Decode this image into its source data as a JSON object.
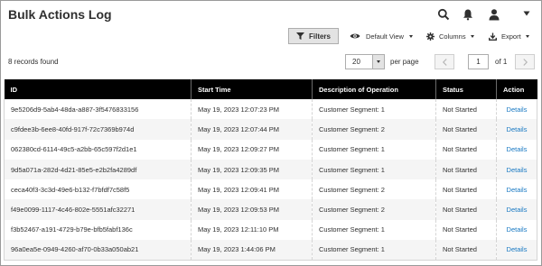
{
  "page": {
    "title": "Bulk Actions Log"
  },
  "toolbar": {
    "filters_label": "Filters",
    "view_label": "Default View",
    "columns_label": "Columns",
    "export_label": "Export"
  },
  "header_icons": [
    "search-icon",
    "bell-icon",
    "user-icon",
    "chevron-down-icon"
  ],
  "grid": {
    "records_found": "8 records found",
    "per_page_value": "20",
    "per_page_label": "per page",
    "page_value": "1",
    "page_of": "of 1",
    "columns": [
      "ID",
      "Start Time",
      "Description of Operation",
      "Status",
      "Action"
    ],
    "rows": [
      {
        "id": "9e5206d9-5ab4-48da-a887-3f5476833156",
        "start": "May 19, 2023 12:07:23 PM",
        "desc": "Customer Segment: 1",
        "status": "Not Started",
        "action": "Details"
      },
      {
        "id": "c9fdee3b-6ee8-40fd-917f-72c7369b974d",
        "start": "May 19, 2023 12:07:44 PM",
        "desc": "Customer Segment: 2",
        "status": "Not Started",
        "action": "Details"
      },
      {
        "id": "062380cd-6114-49c5-a2bb-65c597f2d1e1",
        "start": "May 19, 2023 12:09:27 PM",
        "desc": "Customer Segment: 1",
        "status": "Not Started",
        "action": "Details"
      },
      {
        "id": "9d5a071a-282d-4d21-85e5-e2b2fa4289df",
        "start": "May 19, 2023 12:09:35 PM",
        "desc": "Customer Segment: 1",
        "status": "Not Started",
        "action": "Details"
      },
      {
        "id": "ceca40f3-3c3d-49e6-b132-f7bfdf7c58f5",
        "start": "May 19, 2023 12:09:41 PM",
        "desc": "Customer Segment: 2",
        "status": "Not Started",
        "action": "Details"
      },
      {
        "id": "f49e0099-1117-4c46-802e-5551afc32271",
        "start": "May 19, 2023 12:09:53 PM",
        "desc": "Customer Segment: 2",
        "status": "Not Started",
        "action": "Details"
      },
      {
        "id": "f3b52467-a191-4729-b79e-bfb5fabf136c",
        "start": "May 19, 2023 12:11:10 PM",
        "desc": "Customer Segment: 1",
        "status": "Not Started",
        "action": "Details"
      },
      {
        "id": "96a0ea5e-0949-4260-af70-0b33a050ab21",
        "start": "May 19, 2023 1:44:06 PM",
        "desc": "Customer Segment: 1",
        "status": "Not Started",
        "action": "Details"
      }
    ]
  },
  "colors": {
    "link": "#1979c3",
    "header_bg": "#000000",
    "button_bg": "#e3e3e3"
  }
}
